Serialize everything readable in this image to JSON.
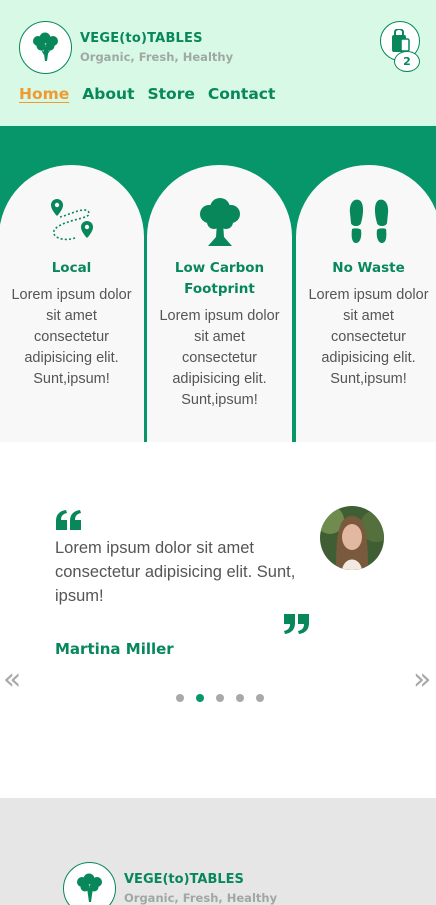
{
  "header": {
    "brand_name": "VEGE(to)TABLES",
    "brand_tagline": "Organic, Fresh, Healthy",
    "logo_icon": "broccoli-icon",
    "cart_icon": "shopping-bag-icon",
    "cart_count": "2",
    "nav": [
      {
        "label": "Home",
        "active": true
      },
      {
        "label": "About",
        "active": false
      },
      {
        "label": "Store",
        "active": false
      },
      {
        "label": "Contact",
        "active": false
      }
    ]
  },
  "features": [
    {
      "icon": "map-route-icon",
      "title": "Local",
      "description": "Lorem ipsum dolor sit amet consectetur adipisicing elit. Sunt,ipsum!"
    },
    {
      "icon": "tree-icon",
      "title": "Low Carbon Footprint",
      "description": "Lorem ipsum dolor sit amet consectetur adipisicing elit. Sunt,ipsum!"
    },
    {
      "icon": "footprints-icon",
      "title": "No Waste",
      "description": "Lorem ipsum dolor sit amet consectetur adipisicing elit. Sunt,ipsum!"
    }
  ],
  "testimonial": {
    "quote": "Lorem ipsum dolor sit amet consectetur adipisicing elit. Sunt, ipsum!",
    "author": "Martina Miller",
    "prev_arrow": "«",
    "next_arrow": "»",
    "slide_count": 5,
    "active_slide": 2
  },
  "footer": {
    "brand_name": "VEGE(to)TABLES",
    "brand_tagline": "Organic, Fresh, Healthy"
  },
  "colors": {
    "brand_green": "#07875a",
    "section_green": "#07966a",
    "header_bg": "#d7f9e6",
    "active_nav": "#f09a32",
    "footer_bg": "#e6e6e6"
  }
}
